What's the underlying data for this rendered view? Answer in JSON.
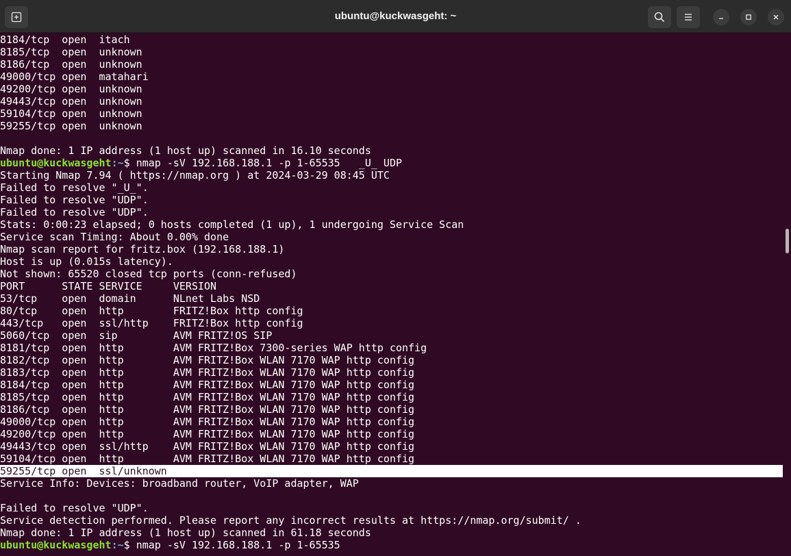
{
  "window": {
    "title": "ubuntu@kuckwasgeht: ~"
  },
  "icons": {
    "new_tab": "new-tab-icon",
    "search": "search-icon",
    "menu": "hamburger-menu-icon",
    "minimize": "minimize-icon",
    "maximize": "maximize-icon",
    "close": "close-icon"
  },
  "colors": {
    "background": "#300a24",
    "titlebar": "#2c2c2c",
    "prompt_user": "#8ae234",
    "prompt_path": "#729fcf",
    "text": "#ffffff"
  },
  "terminal": {
    "lines": [
      "8184/tcp  open  itach",
      "8185/tcp  open  unknown",
      "8186/tcp  open  unknown",
      "49000/tcp open  matahari",
      "49200/tcp open  unknown",
      "49443/tcp open  unknown",
      "59104/tcp open  unknown",
      "59255/tcp open  unknown",
      "",
      "Nmap done: 1 IP address (1 host up) scanned in 16.10 seconds",
      "Starting Nmap 7.94 ( https://nmap.org ) at 2024-03-29 08:45 UTC",
      "Failed to resolve \"_U_\".",
      "Failed to resolve \"UDP\".",
      "Failed to resolve \"UDP\".",
      "Stats: 0:00:23 elapsed; 0 hosts completed (1 up), 1 undergoing Service Scan",
      "Service scan Timing: About 0.00% done",
      "Nmap scan report for fritz.box (192.168.188.1)",
      "Host is up (0.015s latency).",
      "Not shown: 65520 closed tcp ports (conn-refused)",
      "PORT      STATE SERVICE     VERSION",
      "53/tcp    open  domain      NLnet Labs NSD",
      "80/tcp    open  http        FRITZ!Box http config",
      "443/tcp   open  ssl/http    FRITZ!Box http config",
      "5060/tcp  open  sip         AVM FRITZ!OS SIP",
      "8181/tcp  open  http        AVM FRITZ!Box 7300-series WAP http config",
      "8182/tcp  open  http        AVM FRITZ!Box WLAN 7170 WAP http config",
      "8183/tcp  open  http        AVM FRITZ!Box WLAN 7170 WAP http config",
      "8184/tcp  open  http        AVM FRITZ!Box WLAN 7170 WAP http config",
      "8185/tcp  open  http        AVM FRITZ!Box WLAN 7170 WAP http config",
      "8186/tcp  open  http        AVM FRITZ!Box WLAN 7170 WAP http config",
      "49000/tcp open  http        AVM FRITZ!Box WLAN 7170 WAP http config",
      "49200/tcp open  http        AVM FRITZ!Box WLAN 7170 WAP http config",
      "49443/tcp open  ssl/http    AVM FRITZ!Box WLAN 7170 WAP http config",
      "59104/tcp open  http        AVM FRITZ!Box WLAN 7170 WAP http config",
      "59255/tcp open  ssl/unknown",
      "Service Info: Devices: broadband router, VoIP adapter, WAP",
      "",
      "Failed to resolve \"UDP\".",
      "Service detection performed. Please report any incorrect results at https://nmap.org/submit/ .",
      "Nmap done: 1 IP address (1 host up) scanned in 61.18 seconds"
    ],
    "prompt_user": "ubuntu@kuckwasgeht",
    "prompt_path": ":~",
    "prompt_symbol": "$ ",
    "command_1": "nmap -sV 192.168.188.1 -p 1-65535   _U_ UDP",
    "command_2": "nmap -sV 192.168.188.1 -p 1-65535"
  }
}
